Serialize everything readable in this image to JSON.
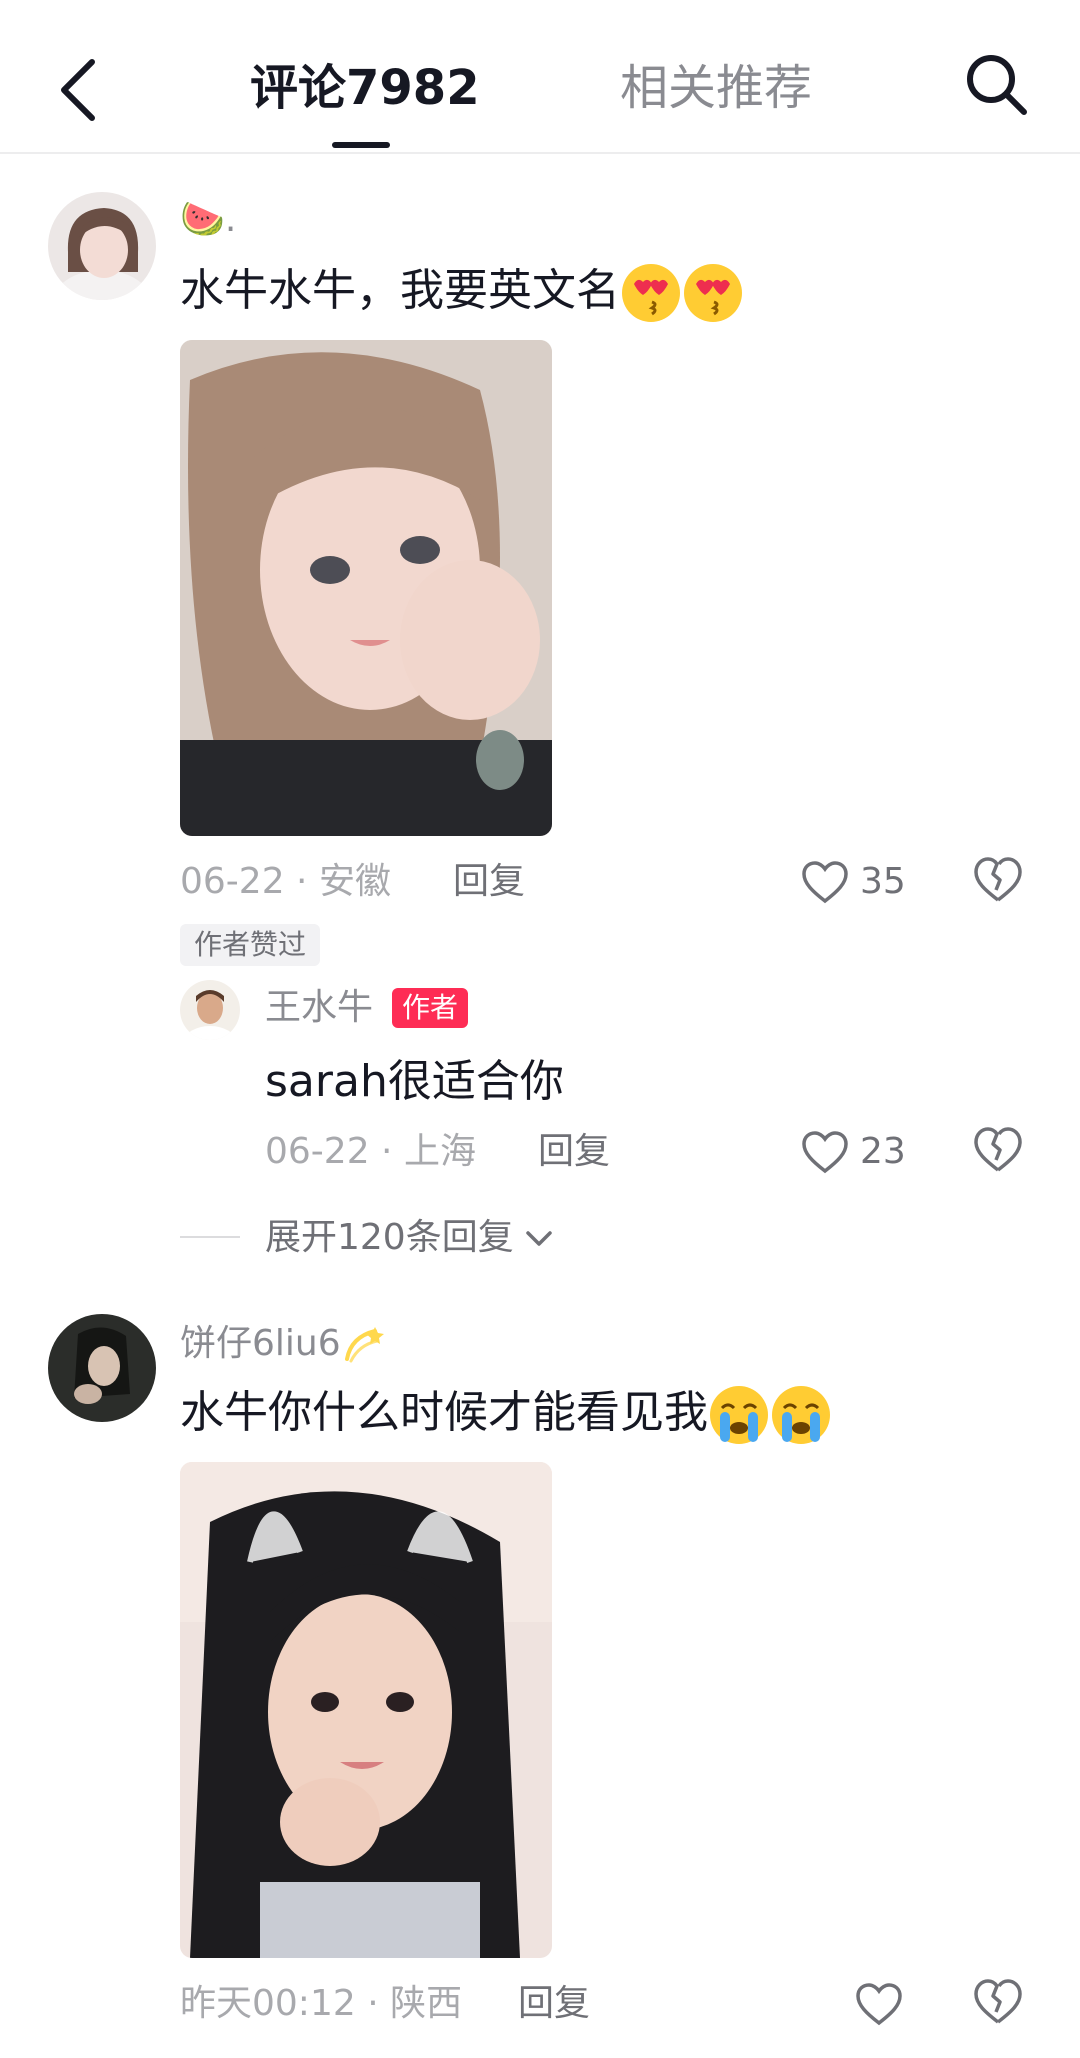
{
  "header": {
    "tab_comments": "评论7982",
    "tab_related": "相关推荐"
  },
  "comments": [
    {
      "username": "🍉.",
      "text": "水牛水牛，我要英文名",
      "emojis": [
        "heart-eyes-emoji",
        "heart-eyes-emoji"
      ],
      "date_location": "06-22 · 安徽",
      "reply_label": "回复",
      "likes": "35",
      "liked_by_author": "作者赞过",
      "replies": [
        {
          "username": "王水牛",
          "author_tag": "作者",
          "text": "sarah很适合你",
          "date_location": "06-22 · 上海",
          "reply_label": "回复",
          "likes": "23"
        }
      ],
      "expand_label": "展开120条回复"
    },
    {
      "username": "饼仔6liu6",
      "username_emoji": "dizzy-emoji",
      "text": "水牛你什么时候才能看见我",
      "emojis": [
        "crying-emoji",
        "crying-emoji"
      ],
      "date_location": "昨天00:12 · 陕西",
      "reply_label": "回复",
      "likes": ""
    }
  ],
  "colors": {
    "accent": "#fe2c55",
    "primary_text": "#161823",
    "secondary_text": "#8a8b91"
  }
}
